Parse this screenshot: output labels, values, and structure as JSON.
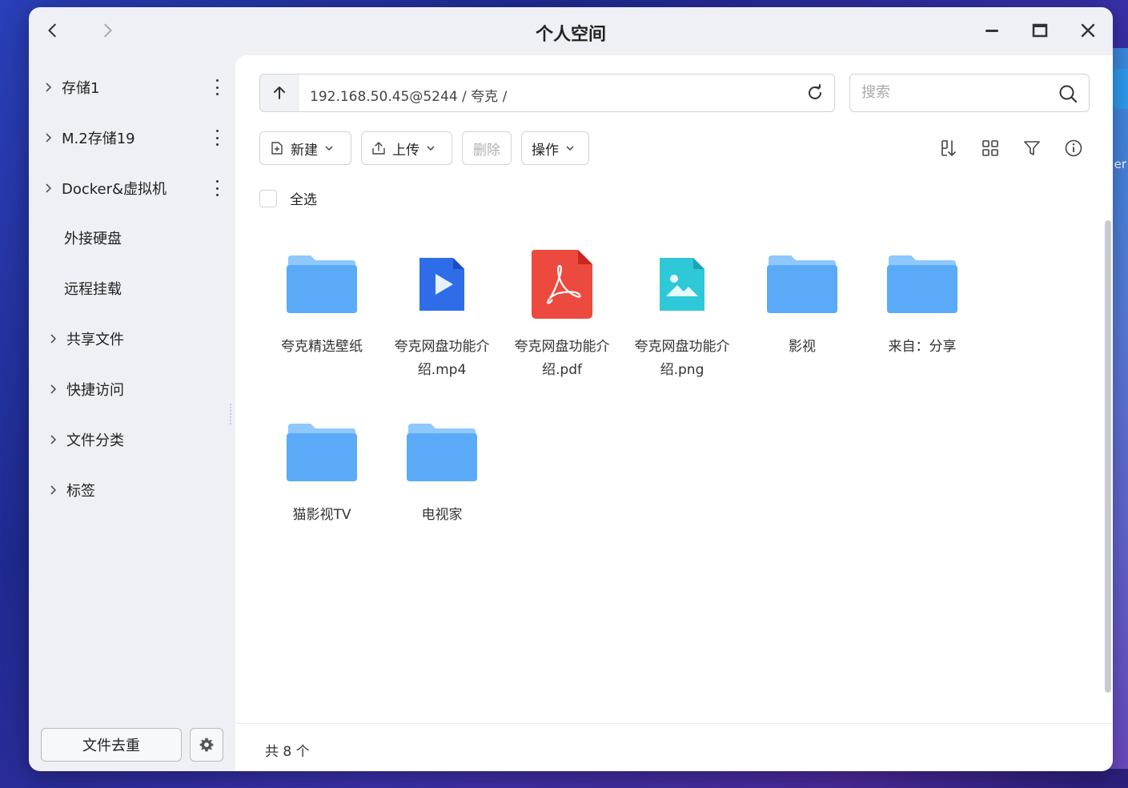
{
  "window": {
    "title": "个人空间"
  },
  "sidebar": {
    "items": [
      {
        "label": "存储1",
        "expandable": true,
        "has_more": true
      },
      {
        "label": "M.2存储19",
        "expandable": true,
        "has_more": true
      },
      {
        "label": "Docker&虚拟机",
        "expandable": true,
        "has_more": true
      },
      {
        "label": "外接硬盘",
        "expandable": false,
        "has_more": false
      },
      {
        "label": "远程挂载",
        "expandable": false,
        "has_more": false
      },
      {
        "label": "共享文件",
        "expandable": true,
        "has_more": false
      },
      {
        "label": "快捷访问",
        "expandable": true,
        "has_more": false
      },
      {
        "label": "文件分类",
        "expandable": true,
        "has_more": false
      },
      {
        "label": "标签",
        "expandable": true,
        "has_more": false
      }
    ],
    "dedup_label": "文件去重"
  },
  "pathbar": {
    "path": "192.168.50.45@5244 / 夸克 /"
  },
  "search": {
    "placeholder": "搜索"
  },
  "toolbar": {
    "new_label": "新建",
    "upload_label": "上传",
    "delete_label": "删除",
    "action_label": "操作"
  },
  "select_all_label": "全选",
  "files": [
    {
      "name": "夸克精选壁纸",
      "type": "folder"
    },
    {
      "name": "夸克网盘功能介绍.mp4",
      "type": "video"
    },
    {
      "name": "夸克网盘功能介绍.pdf",
      "type": "pdf"
    },
    {
      "name": "夸克网盘功能介绍.png",
      "type": "image"
    },
    {
      "name": "影视",
      "type": "folder"
    },
    {
      "name": "来自：分享",
      "type": "folder"
    },
    {
      "name": "猫影视TV",
      "type": "folder"
    },
    {
      "name": "电视家",
      "type": "folder"
    }
  ],
  "footer": {
    "count_text": "共 8 个"
  },
  "background": {
    "partial_text": "er"
  },
  "colors": {
    "folder": "#5aaaf8",
    "video": "#2f6de8",
    "pdf": "#e8403a",
    "image": "#2ec8d8"
  }
}
